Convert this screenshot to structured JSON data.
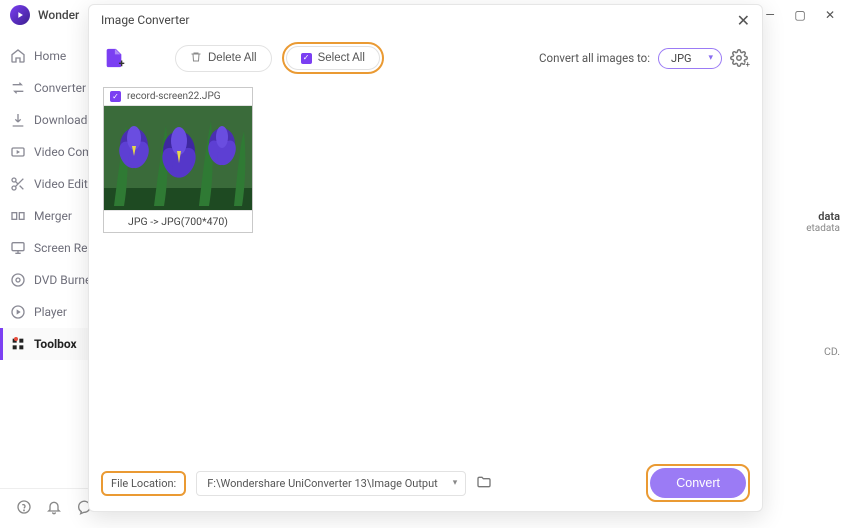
{
  "app": {
    "title": "Wonder"
  },
  "window_controls": {
    "minimize": "—",
    "maximize": "▢",
    "close": "✕"
  },
  "sidebar": {
    "items": [
      {
        "label": "Home"
      },
      {
        "label": "Converter"
      },
      {
        "label": "Downloader"
      },
      {
        "label": "Video Compressor"
      },
      {
        "label": "Video Editor"
      },
      {
        "label": "Merger"
      },
      {
        "label": "Screen Recorder"
      },
      {
        "label": "DVD Burner"
      },
      {
        "label": "Player"
      },
      {
        "label": "Toolbox"
      }
    ]
  },
  "dialog": {
    "title": "Image Converter",
    "toolbar": {
      "delete_all": "Delete All",
      "select_all": "Select All",
      "convert_label": "Convert all images to:",
      "format": "JPG"
    },
    "items": [
      {
        "filename": "record-screen22.JPG",
        "conversion": "JPG -> JPG(700*470)"
      }
    ],
    "footer": {
      "location_label": "File Location:",
      "location_path": "F:\\Wondershare UniConverter 13\\Image Output",
      "convert": "Convert"
    }
  },
  "bg_panel": {
    "text1": "data",
    "text2": "etadata",
    "text3": "CD."
  }
}
